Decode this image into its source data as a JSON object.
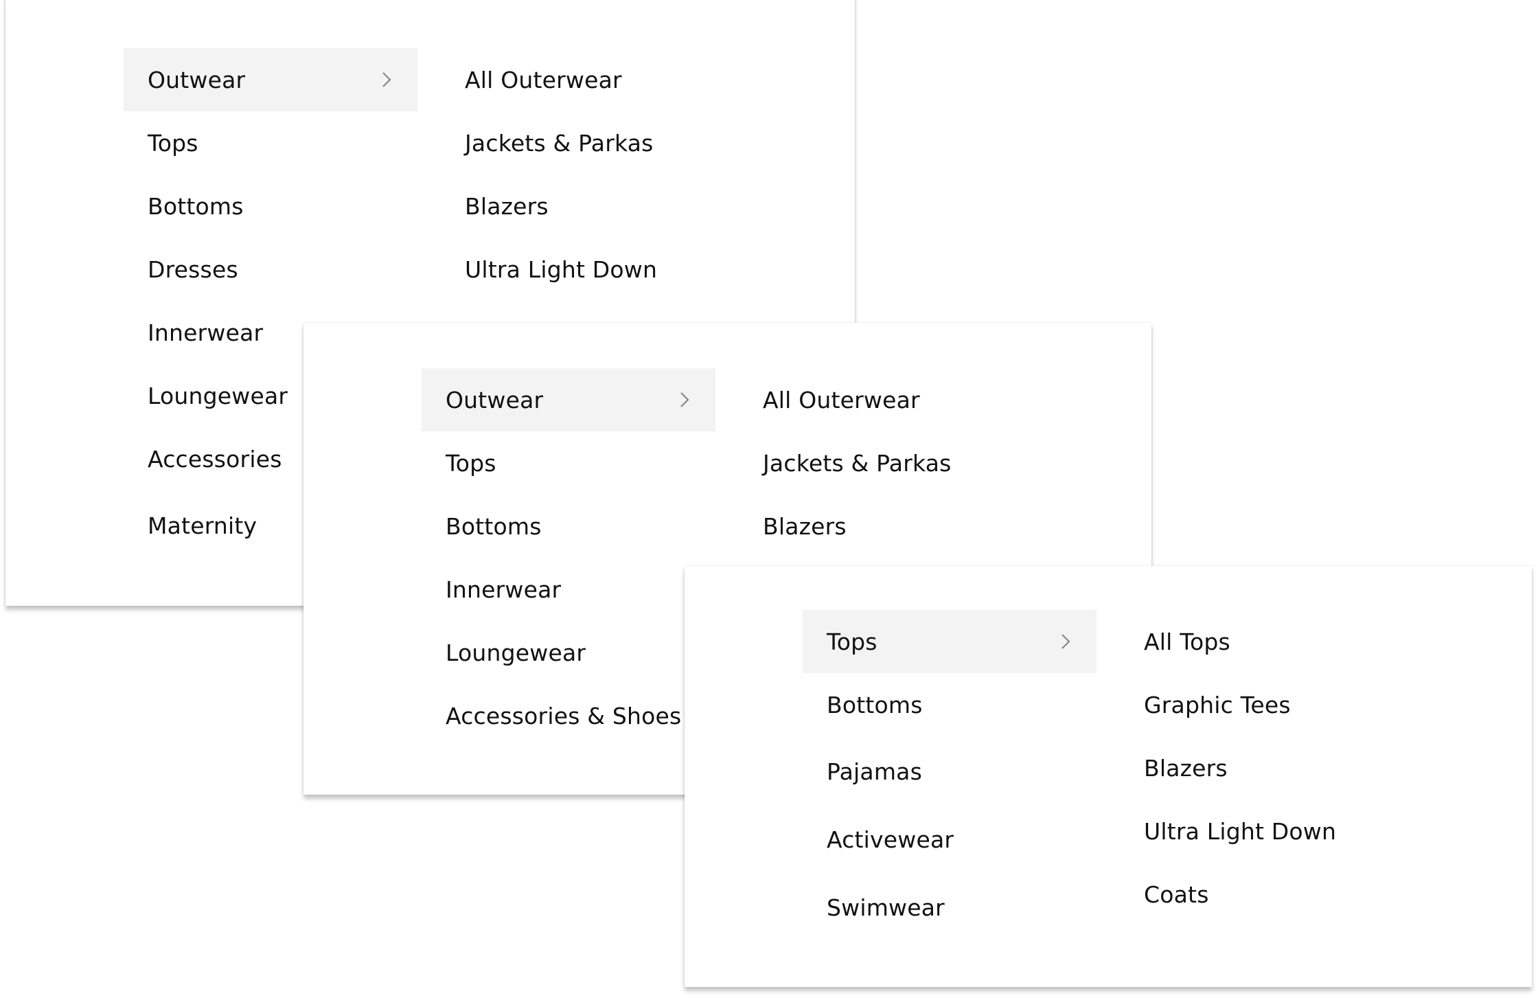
{
  "menus": [
    {
      "categories": [
        "Outwear",
        "Tops",
        "Bottoms",
        "Dresses",
        "Innerwear",
        "Loungewear",
        "Accessories",
        "Maternity"
      ],
      "active": "Outwear",
      "subcategories": [
        "All Outerwear",
        "Jackets & Parkas",
        "Blazers",
        "Ultra Light Down"
      ]
    },
    {
      "categories": [
        "Outwear",
        "Tops",
        "Bottoms",
        "Innerwear",
        "Loungewear",
        "Accessories & Shoes"
      ],
      "active": "Outwear",
      "subcategories": [
        "All Outerwear",
        "Jackets & Parkas",
        "Blazers"
      ]
    },
    {
      "categories": [
        "Tops",
        "Bottoms",
        "Pajamas",
        "Activewear",
        "Swimwear"
      ],
      "active": "Tops",
      "subcategories": [
        "All Tops",
        "Graphic Tees",
        "Blazers",
        "Ultra Light Down",
        "Coats"
      ]
    }
  ],
  "icons": {
    "chevron": "chevron-right-icon"
  },
  "colors": {
    "active_bg": "#f3f3f3",
    "text": "#111111",
    "chevron": "#888888"
  }
}
